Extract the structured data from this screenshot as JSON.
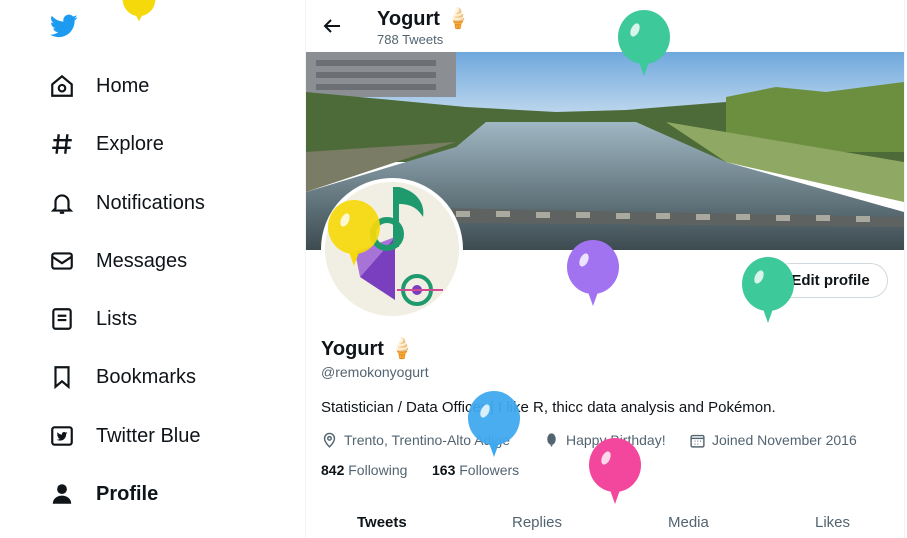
{
  "sidebar": {
    "items": [
      {
        "label": "Home",
        "icon": "home-icon"
      },
      {
        "label": "Explore",
        "icon": "hashtag-icon"
      },
      {
        "label": "Notifications",
        "icon": "bell-icon"
      },
      {
        "label": "Messages",
        "icon": "envelope-icon"
      },
      {
        "label": "Lists",
        "icon": "list-icon"
      },
      {
        "label": "Bookmarks",
        "icon": "bookmark-icon"
      },
      {
        "label": "Twitter Blue",
        "icon": "twitter-blue-icon"
      },
      {
        "label": "Profile",
        "icon": "person-icon",
        "active": true
      }
    ]
  },
  "header": {
    "name": "Yogurt 🍦",
    "tweet_count": "788 Tweets"
  },
  "profile": {
    "display_name": "Yogurt 🍦",
    "handle": "@remokonyogurt",
    "bio": "Statistician / Data Officer | I like R, thicc data analysis and Pokémon.",
    "location": "Trento, Trentino-Alto Adige",
    "birthday": "Happy Birthday!",
    "joined": "Joined November 2016",
    "following_count": "842",
    "following_label": "Following",
    "followers_count": "163",
    "followers_label": "Followers",
    "edit_button": "Edit profile"
  },
  "tabs": [
    "Tweets",
    "Replies",
    "Media",
    "Likes"
  ],
  "colors": {
    "brand_blue": "#1d9bf0",
    "balloon_yellow": "#f5d90a",
    "balloon_green": "#3ec99a",
    "balloon_purple": "#a273f0",
    "balloon_blue": "#3fa9ef",
    "balloon_pink": "#f2479c"
  }
}
